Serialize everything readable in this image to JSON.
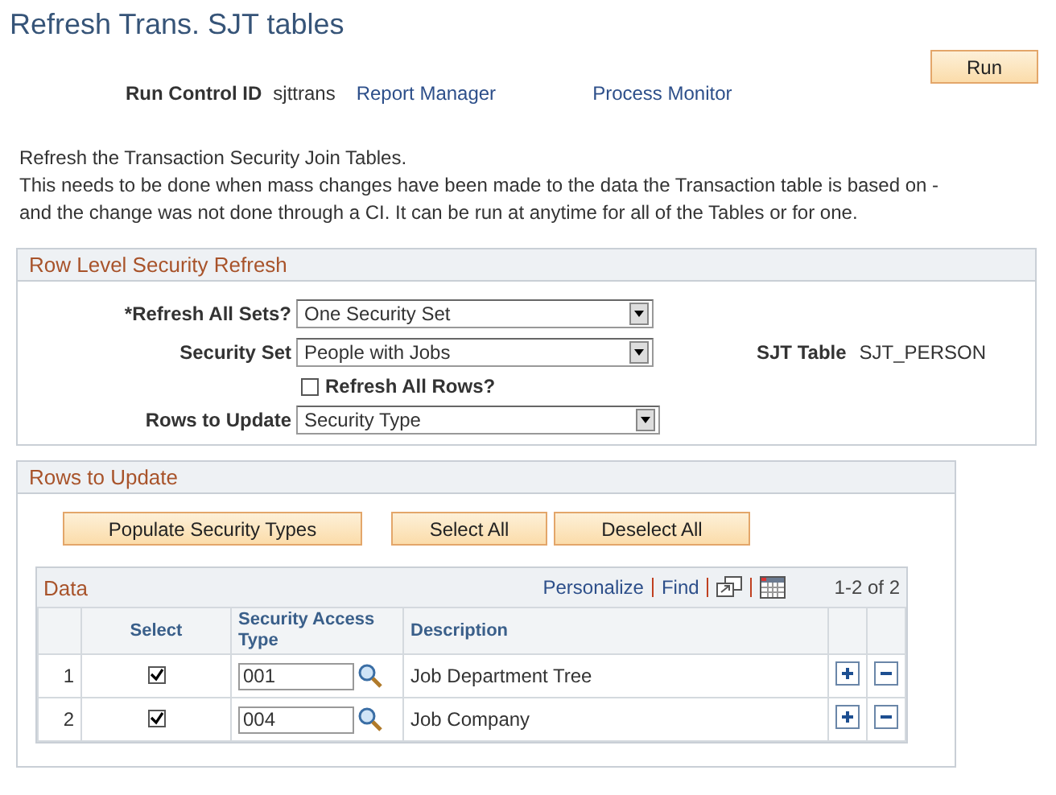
{
  "page_title": "Refresh Trans. SJT tables",
  "run_control": {
    "label": "Run Control ID",
    "value": "sjttrans",
    "links": [
      "Report Manager",
      "Process Monitor"
    ],
    "run_button": "Run"
  },
  "description": [
    "Refresh the Transaction Security Join Tables.",
    "This needs to be done when mass changes have been made to the data the Transaction table is based on -",
    "and the change was not done through a CI. It can be run at anytime for all of the Tables or for one."
  ],
  "row_level_security_refresh": {
    "title": "Row Level Security Refresh",
    "refresh_all_sets": {
      "label": "*Refresh All Sets?",
      "value": "One Security Set"
    },
    "security_set": {
      "label": "Security Set",
      "value": "People with Jobs"
    },
    "sjt_table": {
      "label": "SJT Table",
      "value": "SJT_PERSON"
    },
    "refresh_all_rows": {
      "label": "Refresh All Rows?",
      "checked": false
    },
    "rows_to_update": {
      "label": "Rows to Update",
      "value": "Security Type"
    }
  },
  "rows_to_update": {
    "title": "Rows to Update",
    "buttons": [
      "Populate Security Types",
      "Select All",
      "Deselect All"
    ],
    "grid": {
      "title": "Data",
      "links": [
        "Personalize",
        "Find"
      ],
      "range": "1-2 of 2",
      "columns": [
        "Select",
        "Security Access Type",
        "Description"
      ],
      "rows": [
        {
          "number": "1",
          "selected": true,
          "security_access_type": "001",
          "description": "Job Department Tree"
        },
        {
          "number": "2",
          "selected": true,
          "security_access_type": "004",
          "description": "Job Company"
        }
      ]
    }
  }
}
